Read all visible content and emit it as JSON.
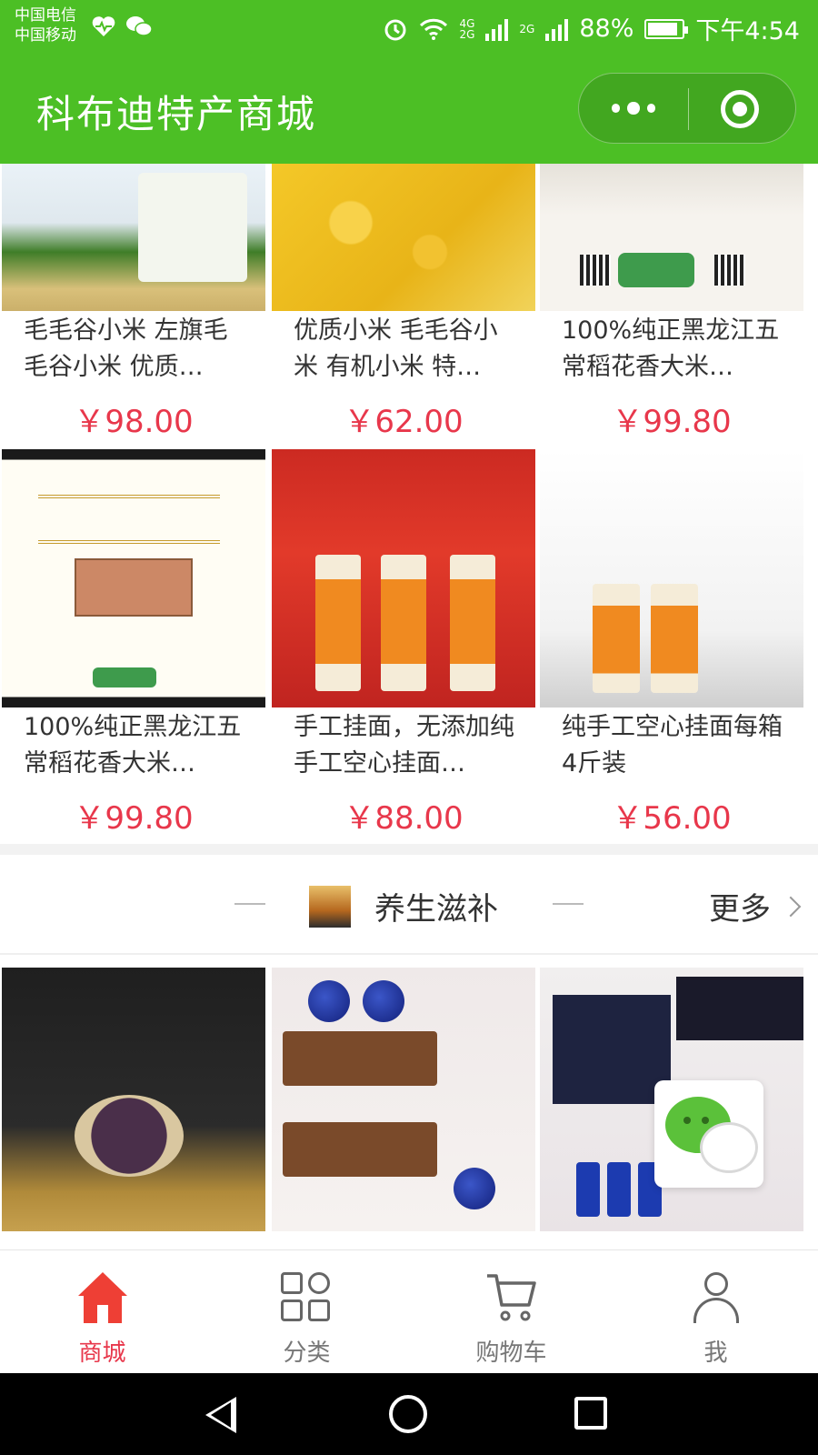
{
  "status_bar": {
    "carrier_1": "中国电信",
    "carrier_2": "中国移动",
    "network_1": "4G",
    "network_2": "2G",
    "network_3": "2G",
    "battery_percent": "88%",
    "battery_level": 0.88,
    "time": "下午4:54",
    "icons": [
      "heart-rate-icon",
      "wechat-icon",
      "alarm-icon",
      "wifi-icon",
      "signal-icon",
      "battery-icon"
    ]
  },
  "header": {
    "title": "科布迪特产商城",
    "capsule_icons": [
      "more-dots-icon",
      "close-target-icon"
    ]
  },
  "products_top": [
    {
      "name": "毛毛谷小米 左旗毛毛谷小米 优质…",
      "price": "￥98.00"
    },
    {
      "name": "优质小米 毛毛谷小米 有机小米 特…",
      "price": "￥62.00"
    },
    {
      "name": "100%纯正黑龙江五常稻花香大米…",
      "price": "￥99.80"
    },
    {
      "name": "100%纯正黑龙江五常稻花香大米…",
      "price": "￥99.80"
    },
    {
      "name": "手工挂面，无添加纯手工空心挂面…",
      "price": "￥88.00"
    },
    {
      "name": "纯手工空心挂面每箱4斤装",
      "price": "￥56.00"
    }
  ],
  "section": {
    "title": "养生滋补",
    "more_label": "更多"
  },
  "tabbar": {
    "tabs": [
      {
        "label": "商城",
        "icon": "home-icon",
        "active": true
      },
      {
        "label": "分类",
        "icon": "category-icon",
        "active": false
      },
      {
        "label": "购物车",
        "icon": "cart-icon",
        "active": false
      },
      {
        "label": "我",
        "icon": "profile-icon",
        "active": false
      }
    ]
  },
  "colors": {
    "brand_green": "#4cbf25",
    "price_red": "#e8374b",
    "active_tab": "#e8374b"
  }
}
